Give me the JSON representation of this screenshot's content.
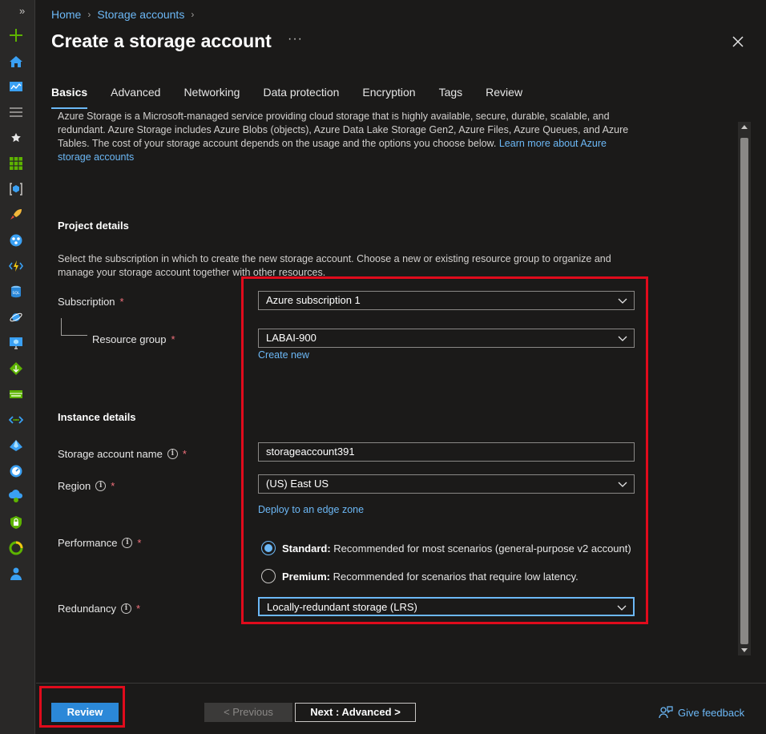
{
  "breadcrumb": [
    "Home",
    "Storage accounts"
  ],
  "page_title": "Create a storage account",
  "more_label": "···",
  "tabs": [
    "Basics",
    "Advanced",
    "Networking",
    "Data protection",
    "Encryption",
    "Tags",
    "Review"
  ],
  "active_tab": "Basics",
  "intro": {
    "text": "Azure Storage is a Microsoft-managed service providing cloud storage that is highly available, secure, durable, scalable, and redundant. Azure Storage includes Azure Blobs (objects), Azure Data Lake Storage Gen2, Azure Files, Azure Queues, and Azure Tables. The cost of your storage account depends on the usage and the options you choose below.",
    "link": "Learn more about Azure storage accounts"
  },
  "project_details": {
    "heading": "Project details",
    "description": "Select the subscription in which to create the new storage account. Choose a new or existing resource group to organize and manage your storage account together with other resources.",
    "subscription_label": "Subscription",
    "subscription_value": "Azure subscription 1",
    "resource_group_label": "Resource group",
    "resource_group_value": "LABAI-900",
    "create_new": "Create new"
  },
  "instance_details": {
    "heading": "Instance details",
    "name_label": "Storage account name",
    "name_value": "storageaccount391",
    "region_label": "Region",
    "region_value": "(US) East US",
    "edge_zone_link": "Deploy to an edge zone",
    "performance_label": "Performance",
    "performance_options": [
      {
        "title": "Standard:",
        "desc": "Recommended for most scenarios (general-purpose v2 account)",
        "checked": true
      },
      {
        "title": "Premium:",
        "desc": "Recommended for scenarios that require low latency.",
        "checked": false
      }
    ],
    "redundancy_label": "Redundancy",
    "redundancy_value": "Locally-redundant storage (LRS)"
  },
  "required_mark": "*",
  "info_mark": "i",
  "footer": {
    "review": "Review",
    "previous": "< Previous",
    "next": "Next : Advanced >",
    "feedback": "Give feedback"
  },
  "colors": {
    "accent": "#6cb8f6",
    "primary_button": "#2b88d8",
    "highlight": "#e00b1c",
    "background": "#1b1a19"
  },
  "rail_icons": [
    "expand-icon",
    "create-icon",
    "home-icon",
    "dashboard-icon",
    "all-services-icon",
    "favorites-star-icon",
    "all-resources-icon",
    "resource-groups-icon",
    "quickstart-icon",
    "app-services-icon",
    "function-app-icon",
    "sql-database-icon",
    "cosmos-db-icon",
    "virtual-machines-icon",
    "load-balancer-icon",
    "storage-accounts-icon",
    "virtual-network-icon",
    "entra-id-icon",
    "monitor-icon",
    "advisor-icon",
    "defender-icon",
    "cost-management-icon",
    "help-support-icon"
  ]
}
